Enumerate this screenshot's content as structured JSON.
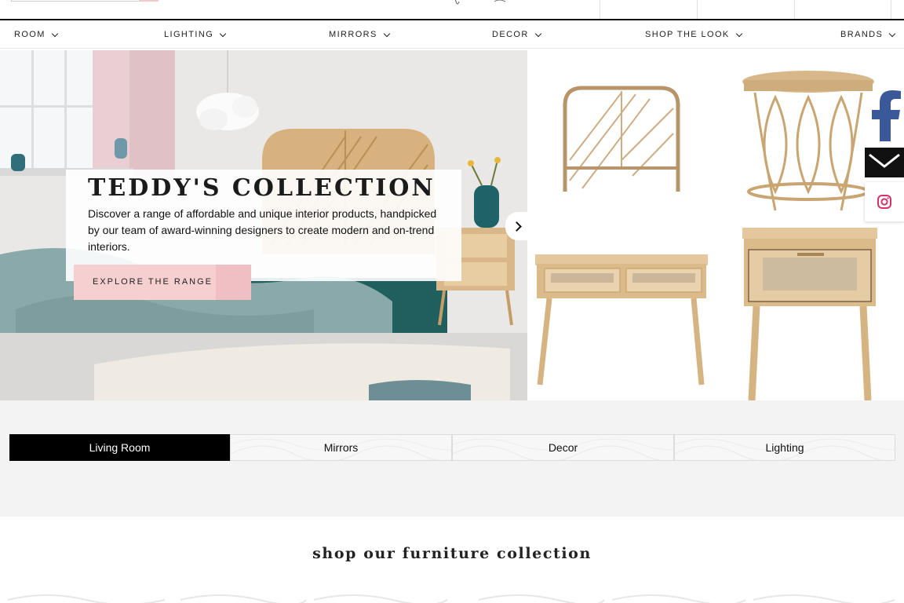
{
  "nav": {
    "items": [
      {
        "label": "ROOM"
      },
      {
        "label": "LIGHTING"
      },
      {
        "label": "MIRRORS"
      },
      {
        "label": "DECOR"
      },
      {
        "label": "SHOP THE LOOK"
      },
      {
        "label": "BRANDS"
      }
    ]
  },
  "hero": {
    "title": "TEDDY'S COLLECTION",
    "description": "Discover a range of affordable and unique interior products, handpicked by our team of award-winning designers to create modern and on-trend interiors.",
    "cta_label": "EXPLORE THE RANGE",
    "next_icon": "chevron-right-icon"
  },
  "social": {
    "icons": [
      "facebook-icon",
      "mail-icon",
      "instagram-icon"
    ]
  },
  "tabs": [
    {
      "label": "Living Room",
      "active": true
    },
    {
      "label": "Mirrors",
      "active": false
    },
    {
      "label": "Decor",
      "active": false
    },
    {
      "label": "Lighting",
      "active": false
    }
  ],
  "shop": {
    "title": "shop our furniture collection"
  },
  "colors": {
    "accent_pink": "#f6cfd1",
    "active_tab": "#000000",
    "band_bg": "#f3f3f3",
    "facebook_blue": "#3b5998",
    "instagram_red": "#d6336c"
  }
}
